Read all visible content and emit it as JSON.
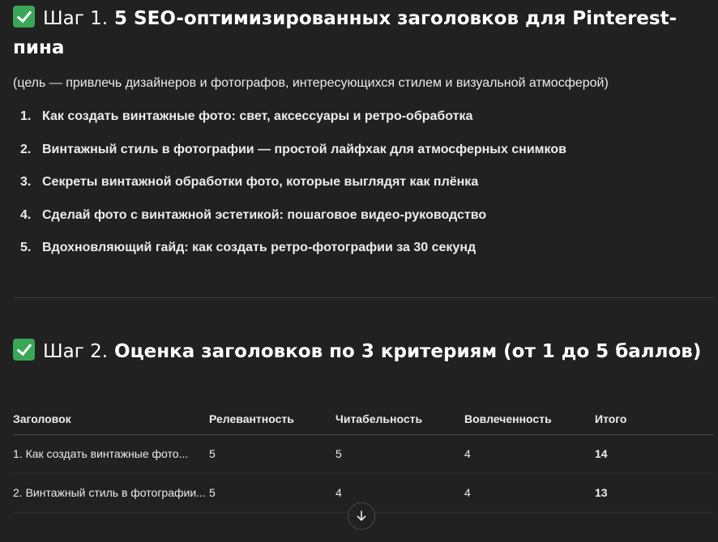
{
  "step1": {
    "prefix": "Шаг 1.",
    "title": "5 SEO-оптимизированных заголовков для Pinterest-пина",
    "intro": "(цель — привлечь дизайнеров и фотографов, интересующихся стилем и визуальной атмосферой)",
    "items": [
      {
        "num": "1.",
        "text": "Как создать винтажные фото: свет, аксессуары и ретро-обработка"
      },
      {
        "num": "2.",
        "text": "Винтажный стиль в фотографии — простой лайфхак для атмосферных снимков"
      },
      {
        "num": "3.",
        "text": "Секреты винтажной обработки фото, которые выглядят как плёнка"
      },
      {
        "num": "4.",
        "text": "Сделай фото с винтажной эстетикой: пошаговое видео-руководство"
      },
      {
        "num": "5.",
        "text": "Вдохновляющий гайд: как создать ретро-фотографии за 30 секунд"
      }
    ]
  },
  "step2": {
    "prefix": "Шаг 2.",
    "title": "Оценка заголовков по 3 критериям (от 1 до 5 баллов)"
  },
  "table": {
    "headers": [
      "Заголовок",
      "Релевантность",
      "Читабельность",
      "Вовлеченность",
      "Итого"
    ],
    "rows": [
      {
        "title": "1. Как создать винтажные фото...",
        "relevance": "5",
        "readability": "5",
        "engagement": "4",
        "total": "14"
      },
      {
        "title": "2. Винтажный стиль в фотографии...",
        "relevance": "5",
        "readability": "4",
        "engagement": "4",
        "total": "13"
      }
    ]
  },
  "icons": {
    "check": "check-mark-icon",
    "scroll": "arrow-down-icon"
  },
  "colors": {
    "background": "#212121",
    "check_bg": "#3aa757",
    "text": "#ececec"
  }
}
